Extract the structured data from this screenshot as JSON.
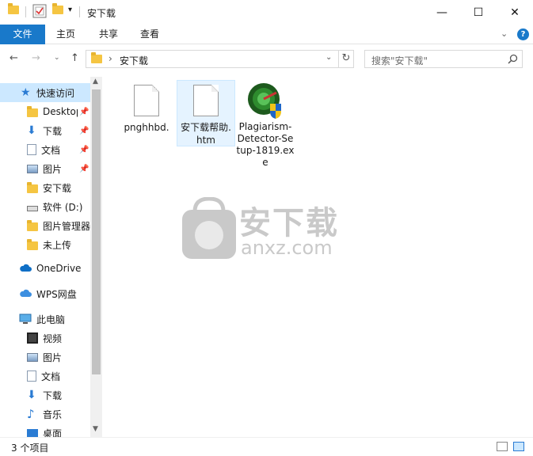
{
  "window": {
    "title": "安下载",
    "minimize_glyph": "—",
    "maximize_glyph": "☐",
    "close_glyph": "✕"
  },
  "ribbon": {
    "tabs": [
      {
        "label": "文件",
        "active": true
      },
      {
        "label": "主页"
      },
      {
        "label": "共享"
      },
      {
        "label": "查看"
      }
    ]
  },
  "address": {
    "path": "安下载",
    "separator": "›",
    "search_placeholder": "搜索\"安下载\""
  },
  "sidebar": {
    "items": [
      {
        "label": "快速访问",
        "icon": "star-icon",
        "selected": true,
        "level": 0
      },
      {
        "label": "Desktop",
        "icon": "folder-icon",
        "pinned": true,
        "level": 1
      },
      {
        "label": "下载",
        "icon": "download-icon",
        "pinned": true,
        "level": 1
      },
      {
        "label": "文档",
        "icon": "document-icon",
        "pinned": true,
        "level": 1
      },
      {
        "label": "图片",
        "icon": "picture-icon",
        "pinned": true,
        "level": 1
      },
      {
        "label": "安下载",
        "icon": "folder-icon",
        "level": 1
      },
      {
        "label": "软件 (D:)",
        "icon": "drive-icon",
        "level": 1
      },
      {
        "label": "图片管理器",
        "icon": "folder-icon",
        "level": 1
      },
      {
        "label": "未上传",
        "icon": "folder-icon",
        "level": 1
      },
      {
        "label": "OneDrive",
        "icon": "cloud-icon",
        "level": 0
      },
      {
        "label": "WPS网盘",
        "icon": "wps-cloud-icon",
        "level": 0
      },
      {
        "label": "此电脑",
        "icon": "computer-icon",
        "level": 0
      },
      {
        "label": "视频",
        "icon": "video-icon",
        "level": 1
      },
      {
        "label": "图片",
        "icon": "picture-icon",
        "level": 1
      },
      {
        "label": "文档",
        "icon": "document-icon",
        "level": 1
      },
      {
        "label": "下载",
        "icon": "download-icon",
        "level": 1
      },
      {
        "label": "音乐",
        "icon": "music-icon",
        "level": 1
      },
      {
        "label": "桌面",
        "icon": "desktop-icon",
        "level": 1
      }
    ]
  },
  "files": [
    {
      "name": "pnghhbd.",
      "icon": "blank-file-icon"
    },
    {
      "name": "安下载帮助.htm",
      "icon": "blank-file-icon",
      "selected": true
    },
    {
      "name": "Plagiarism-Detector-Setup-1819.exe",
      "icon": "installer-icon"
    }
  ],
  "watermark": {
    "title": "安下载",
    "subtitle": "anxz.com"
  },
  "status": {
    "count": "3 个项目"
  },
  "colors": {
    "accent": "#1979ca",
    "selection": "#cce8ff",
    "folder": "#f5c542"
  }
}
